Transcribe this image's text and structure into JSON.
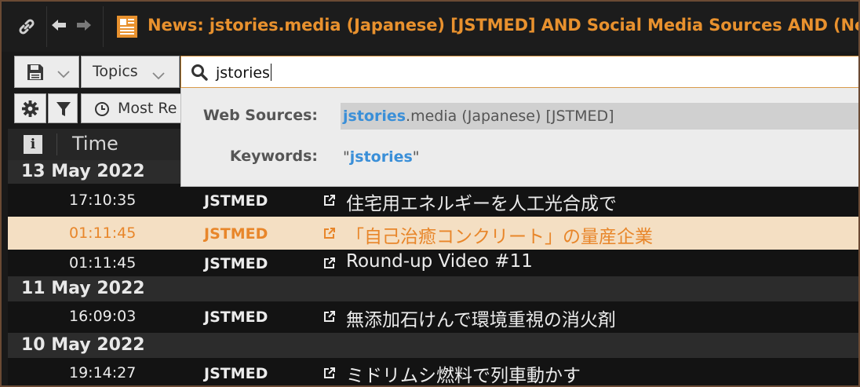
{
  "window": {
    "title": "News: jstories.media (Japanese) [JSTMED] AND Social Media Sources AND (News Wires S",
    "link_icon": "link-icon",
    "back_icon": "arrow-left-icon",
    "forward_icon": "arrow-right-icon",
    "news_icon": "newspaper-icon",
    "accent_color": "#e8912e"
  },
  "toolbar": {
    "save_icon": "floppy-disk-icon",
    "topics_label": "Topics",
    "search": {
      "value": "jstories"
    },
    "settings_icon": "gear-icon",
    "filter_icon": "funnel-icon",
    "sort_label": "Most Re",
    "sort_icon": "clock-icon"
  },
  "autocomplete": {
    "web_sources_label": "Web Sources:",
    "web_sources_match": "jstories",
    "web_sources_rest": ".media (Japanese) [JSTMED]",
    "keywords_label": "Keywords:",
    "keyword_open_quote": "\"",
    "keyword_match": "jstories",
    "keyword_close_quote": "\"",
    "highlight_color": "#3a8fd8"
  },
  "columns": {
    "info_label": "i",
    "time_label": "Time"
  },
  "groups": [
    {
      "date": "13 May 2022",
      "items": [
        {
          "time": "17:10:35",
          "source": "JSTMED",
          "headline": "住宅用エネルギーを人工光合成で"
        },
        {
          "time": "01:11:45",
          "source": "JSTMED",
          "headline": "「自己治癒コンクリート」の量産企業",
          "selected": true
        },
        {
          "time": "01:11:45",
          "source": "JSTMED",
          "headline": "Round-up Video #11"
        }
      ]
    },
    {
      "date": "11 May 2022",
      "items": [
        {
          "time": "16:09:03",
          "source": "JSTMED",
          "headline": "無添加石けんで環境重視の消火剤"
        }
      ]
    },
    {
      "date": "10 May 2022",
      "items": [
        {
          "time": "19:14:27",
          "source": "JSTMED",
          "headline": "ミドリムシ燃料で列車動かす"
        }
      ]
    }
  ]
}
